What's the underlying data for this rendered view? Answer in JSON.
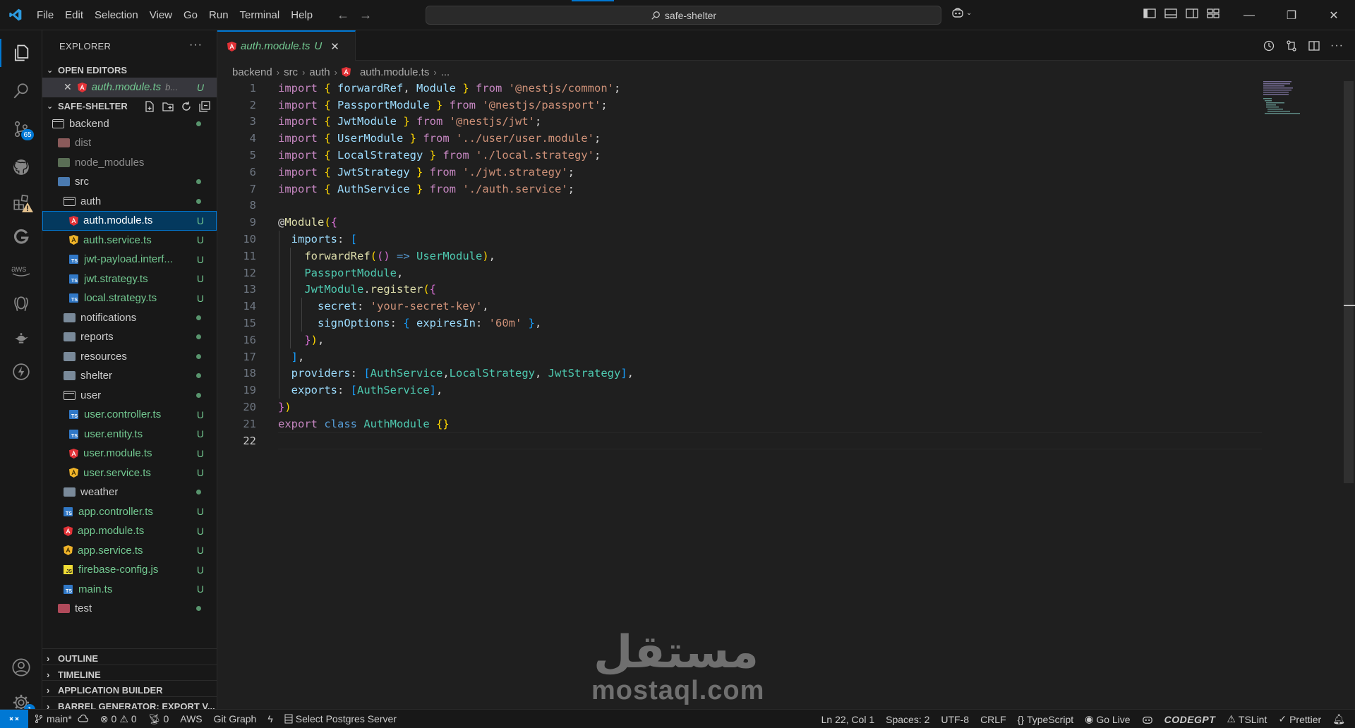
{
  "window": {
    "menu": [
      "File",
      "Edit",
      "Selection",
      "View",
      "Go",
      "Run",
      "Terminal",
      "Help"
    ],
    "search_text": "safe-shelter"
  },
  "activity": {
    "source_control_badge": "65",
    "settings_badge": "1"
  },
  "explorer": {
    "title": "EXPLORER",
    "open_editors_title": "OPEN EDITORS",
    "open_editor": {
      "name": "auth.module.ts",
      "path": "b...",
      "status": "U"
    },
    "project_title": "SAFE-SHELTER",
    "tree": [
      {
        "name": "backend",
        "type": "folder-open",
        "depth": 0,
        "status": "dot"
      },
      {
        "name": "dist",
        "type": "folder-dist",
        "depth": 1,
        "status": ""
      },
      {
        "name": "node_modules",
        "type": "folder-node",
        "depth": 1,
        "status": ""
      },
      {
        "name": "src",
        "type": "folder-src",
        "depth": 1,
        "status": "dot"
      },
      {
        "name": "auth",
        "type": "folder-open",
        "depth": 2,
        "status": "dot"
      },
      {
        "name": "auth.module.ts",
        "type": "angular-module",
        "depth": 3,
        "status": "U",
        "selected": true
      },
      {
        "name": "auth.service.ts",
        "type": "angular-service",
        "depth": 3,
        "status": "U"
      },
      {
        "name": "jwt-payload.interf...",
        "type": "ts",
        "depth": 3,
        "status": "U"
      },
      {
        "name": "jwt.strategy.ts",
        "type": "ts",
        "depth": 3,
        "status": "U"
      },
      {
        "name": "local.strategy.ts",
        "type": "ts",
        "depth": 3,
        "status": "U"
      },
      {
        "name": "notifications",
        "type": "folder",
        "depth": 2,
        "status": "dot"
      },
      {
        "name": "reports",
        "type": "folder",
        "depth": 2,
        "status": "dot"
      },
      {
        "name": "resources",
        "type": "folder",
        "depth": 2,
        "status": "dot"
      },
      {
        "name": "shelter",
        "type": "folder",
        "depth": 2,
        "status": "dot"
      },
      {
        "name": "user",
        "type": "folder-open",
        "depth": 2,
        "status": "dot"
      },
      {
        "name": "user.controller.ts",
        "type": "ts",
        "depth": 3,
        "status": "U"
      },
      {
        "name": "user.entity.ts",
        "type": "ts",
        "depth": 3,
        "status": "U"
      },
      {
        "name": "user.module.ts",
        "type": "angular-module",
        "depth": 3,
        "status": "U"
      },
      {
        "name": "user.service.ts",
        "type": "angular-service",
        "depth": 3,
        "status": "U"
      },
      {
        "name": "weather",
        "type": "folder",
        "depth": 2,
        "status": "dot"
      },
      {
        "name": "app.controller.ts",
        "type": "ts",
        "depth": 2,
        "status": "U"
      },
      {
        "name": "app.module.ts",
        "type": "angular-module",
        "depth": 2,
        "status": "U"
      },
      {
        "name": "app.service.ts",
        "type": "angular-service",
        "depth": 2,
        "status": "U"
      },
      {
        "name": "firebase-config.js",
        "type": "js",
        "depth": 2,
        "status": "U"
      },
      {
        "name": "main.ts",
        "type": "ts",
        "depth": 2,
        "status": "U"
      },
      {
        "name": "test",
        "type": "folder-test",
        "depth": 1,
        "status": "dot"
      }
    ],
    "bottom_sections": [
      "OUTLINE",
      "TIMELINE",
      "APPLICATION BUILDER",
      "BARREL GENERATOR: EXPORT V..."
    ]
  },
  "editor": {
    "tab": {
      "name": "auth.module.ts",
      "status": "U"
    },
    "breadcrumb": [
      "backend",
      "src",
      "auth",
      "auth.module.ts",
      "..."
    ],
    "current_line": 22,
    "lines": [
      [
        [
          "import ",
          "k1"
        ],
        [
          "{ ",
          "p1"
        ],
        [
          "forwardRef",
          "id"
        ],
        [
          ", ",
          "pl"
        ],
        [
          "Module",
          "id"
        ],
        [
          " } ",
          "p1"
        ],
        [
          "from ",
          "k1"
        ],
        [
          "'@nestjs/common'",
          "str"
        ],
        [
          ";",
          "pl"
        ]
      ],
      [
        [
          "import ",
          "k1"
        ],
        [
          "{ ",
          "p1"
        ],
        [
          "PassportModule",
          "id"
        ],
        [
          " } ",
          "p1"
        ],
        [
          "from ",
          "k1"
        ],
        [
          "'@nestjs/passport'",
          "str"
        ],
        [
          ";",
          "pl"
        ]
      ],
      [
        [
          "import ",
          "k1"
        ],
        [
          "{ ",
          "p1"
        ],
        [
          "JwtModule",
          "id"
        ],
        [
          " } ",
          "p1"
        ],
        [
          "from ",
          "k1"
        ],
        [
          "'@nestjs/jwt'",
          "str"
        ],
        [
          ";",
          "pl"
        ]
      ],
      [
        [
          "import ",
          "k1"
        ],
        [
          "{ ",
          "p1"
        ],
        [
          "UserModule",
          "id"
        ],
        [
          " } ",
          "p1"
        ],
        [
          "from ",
          "k1"
        ],
        [
          "'../user/user.module'",
          "str"
        ],
        [
          ";",
          "pl"
        ]
      ],
      [
        [
          "import ",
          "k1"
        ],
        [
          "{ ",
          "p1"
        ],
        [
          "LocalStrategy",
          "id"
        ],
        [
          " } ",
          "p1"
        ],
        [
          "from ",
          "k1"
        ],
        [
          "'./local.strategy'",
          "str"
        ],
        [
          ";",
          "pl"
        ]
      ],
      [
        [
          "import ",
          "k1"
        ],
        [
          "{ ",
          "p1"
        ],
        [
          "JwtStrategy",
          "id"
        ],
        [
          " } ",
          "p1"
        ],
        [
          "from ",
          "k1"
        ],
        [
          "'./jwt.strategy'",
          "str"
        ],
        [
          ";",
          "pl"
        ]
      ],
      [
        [
          "import ",
          "k1"
        ],
        [
          "{ ",
          "p1"
        ],
        [
          "AuthService",
          "id"
        ],
        [
          " } ",
          "p1"
        ],
        [
          "from ",
          "k1"
        ],
        [
          "'./auth.service'",
          "str"
        ],
        [
          ";",
          "pl"
        ]
      ],
      [],
      [
        [
          "@",
          "pl"
        ],
        [
          "Module",
          "fn"
        ],
        [
          "(",
          "p1"
        ],
        [
          "{",
          "p2"
        ]
      ],
      [
        [
          "  imports",
          "id"
        ],
        [
          ": ",
          "pl"
        ],
        [
          "[",
          "p3"
        ]
      ],
      [
        [
          "    ",
          "pl"
        ],
        [
          "forwardRef",
          "fn"
        ],
        [
          "(",
          "p1"
        ],
        [
          "()",
          "p2"
        ],
        [
          " => ",
          "k2"
        ],
        [
          "UserModule",
          "cls"
        ],
        [
          ")",
          "p1"
        ],
        [
          ",",
          "pl"
        ]
      ],
      [
        [
          "    PassportModule",
          "cls"
        ],
        [
          ",",
          "pl"
        ]
      ],
      [
        [
          "    JwtModule",
          "cls"
        ],
        [
          ".",
          "pl"
        ],
        [
          "register",
          "fn"
        ],
        [
          "(",
          "p1"
        ],
        [
          "{",
          "p2"
        ]
      ],
      [
        [
          "      secret",
          "id"
        ],
        [
          ": ",
          "pl"
        ],
        [
          "'your-secret-key'",
          "str"
        ],
        [
          ",",
          "pl"
        ]
      ],
      [
        [
          "      signOptions",
          "id"
        ],
        [
          ": ",
          "pl"
        ],
        [
          "{ ",
          "p3"
        ],
        [
          "expiresIn",
          "id"
        ],
        [
          ": ",
          "pl"
        ],
        [
          "'60m'",
          "str"
        ],
        [
          " }",
          "p3"
        ],
        [
          ",",
          "pl"
        ]
      ],
      [
        [
          "    ",
          "pl"
        ],
        [
          "}",
          "p2"
        ],
        [
          ")",
          "p1"
        ],
        [
          ",",
          "pl"
        ]
      ],
      [
        [
          "  ]",
          "p3"
        ],
        [
          ",",
          "pl"
        ]
      ],
      [
        [
          "  providers",
          "id"
        ],
        [
          ": ",
          "pl"
        ],
        [
          "[",
          "p3"
        ],
        [
          "AuthService",
          "cls"
        ],
        [
          ",",
          "pl"
        ],
        [
          "LocalStrategy",
          "cls"
        ],
        [
          ", ",
          "pl"
        ],
        [
          "JwtStrategy",
          "cls"
        ],
        [
          "]",
          "p3"
        ],
        [
          ",",
          "pl"
        ]
      ],
      [
        [
          "  exports",
          "id"
        ],
        [
          ": ",
          "pl"
        ],
        [
          "[",
          "p3"
        ],
        [
          "AuthService",
          "cls"
        ],
        [
          "]",
          "p3"
        ],
        [
          ",",
          "pl"
        ]
      ],
      [
        [
          "}",
          "p2"
        ],
        [
          ")",
          "p1"
        ]
      ],
      [
        [
          "export ",
          "k1"
        ],
        [
          "class ",
          "k2"
        ],
        [
          "AuthModule ",
          "cls"
        ],
        [
          "{}",
          "p1"
        ]
      ],
      []
    ]
  },
  "statusbar": {
    "branch": "main*",
    "errors": "0",
    "warnings": "0",
    "ports": "0",
    "aws": "AWS",
    "git_graph": "Git Graph",
    "postgres": "Select Postgres Server",
    "position": "Ln 22, Col 1",
    "spaces": "Spaces: 2",
    "encoding": "UTF-8",
    "eol": "CRLF",
    "language": "TypeScript",
    "go_live": "Go Live",
    "codegpt": "CODEGPT",
    "tslint": "TSLint",
    "prettier": "Prettier"
  },
  "watermark": {
    "arabic": "مستقل",
    "latin": "mostaql.com"
  },
  "colors": {
    "accent": "#0078d4",
    "untracked": "#73c991",
    "typescript": "#3178c6",
    "angular": "#e23237"
  }
}
